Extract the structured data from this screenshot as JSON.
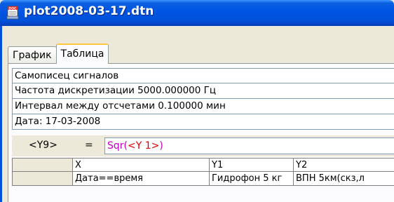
{
  "window": {
    "title": "plot2008-03-17.dtn",
    "icon": "document-app-icon"
  },
  "tabs": [
    {
      "label": "График",
      "active": false
    },
    {
      "label": "Таблица",
      "active": true
    }
  ],
  "info": [
    "Самописец сигналов",
    "Частота дискретизации 5000.000000 Гц",
    "Интервал между отсчетами 0.100000 мин",
    "Дата:  17-03-2008"
  ],
  "formula": {
    "label": "<Y9>",
    "equals": "=",
    "func": "Sqr",
    "open": "(",
    "arg": "<Y 1>",
    "close": ")"
  },
  "grid": {
    "header": [
      "",
      "X",
      "Y1",
      "Y2"
    ],
    "rows": [
      [
        "",
        "Дата==время",
        "Гидрофон 5 кг",
        "ВПН 5км(скз,л"
      ]
    ]
  },
  "colors": {
    "titlebar": "#0054e3",
    "active_tab_accent": "#ffc83c",
    "formula_func": "#c000c0",
    "formula_arg": "#e00000"
  }
}
